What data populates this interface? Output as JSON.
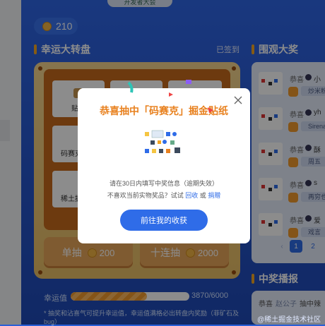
{
  "header": {
    "logo_text": "开发者大会",
    "score": "210"
  },
  "lottery": {
    "title": "幸运大转盘",
    "signed_label": "已签到",
    "cells": [
      "贴纸",
      "码赛克系列",
      "稀土掘金贴"
    ],
    "single_draw": {
      "label": "单抽",
      "cost": "200"
    },
    "ten_draw": {
      "label": "十连抽",
      "cost": "2000"
    },
    "luck": {
      "label": "幸运值",
      "value": "3870/6000",
      "progress": 0.645
    },
    "note": "* 抽奖和沾喜气可提升幸运值，幸运值满格必出转盘内奖励（菲矿石及bug）"
  },
  "winners": {
    "title": "围观大奖",
    "rows": [
      {
        "prefix": "恭喜",
        "user": "小",
        "prize": "炒米粉"
      },
      {
        "prefix": "恭喜",
        "user": "yh",
        "prize": "Sirena"
      },
      {
        "prefix": "恭喜",
        "user": "酥",
        "prize": "周五"
      },
      {
        "prefix": "恭喜",
        "user": "s",
        "prize": "再穷也"
      },
      {
        "prefix": "恭喜",
        "user": "爱",
        "prize": "戏言"
      }
    ],
    "pages": [
      "1",
      "2"
    ]
  },
  "broadcast": {
    "title": "中奖播报",
    "line": {
      "prefix": "恭喜",
      "user": "赵公子",
      "action": "抽中辣"
    }
  },
  "modal": {
    "title": "恭喜抽中「码赛克」掘金贴纸",
    "line1": "请在30日内填写中奖信息（逾期失效）",
    "line2_prefix": "不喜欢当前实物奖品？试试",
    "recycle_link": "回收",
    "or_text": "或",
    "donate_link": "捐赠",
    "go_button": "前往我的收获"
  },
  "watermark": "@稀土掘金技术社区",
  "colors": {
    "accent": "#e8811f",
    "primary": "#2f6ce8",
    "coin": "#f2b544"
  }
}
